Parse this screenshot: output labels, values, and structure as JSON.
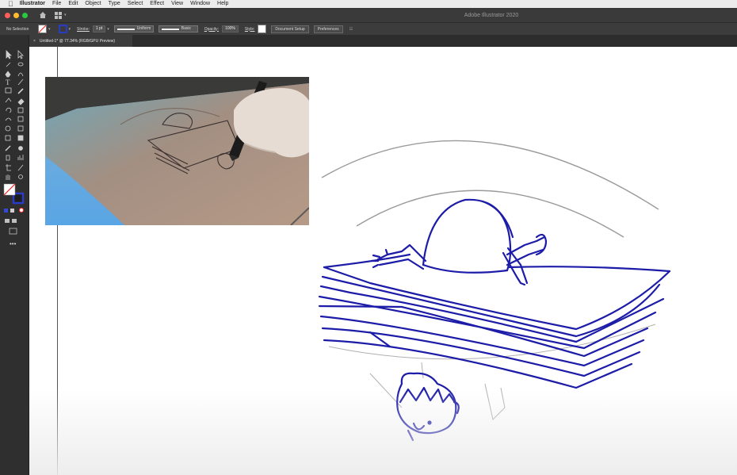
{
  "menubar": {
    "app_name": "Illustrator",
    "items": [
      "File",
      "Edit",
      "Object",
      "Type",
      "Select",
      "Effect",
      "View",
      "Window",
      "Help"
    ]
  },
  "titlebar": {
    "title": "Adobe Illustrator 2020"
  },
  "controlbar": {
    "selection_label": "No Selection",
    "stroke_label": "Stroke:",
    "stroke_weight": "1 pt",
    "profile_value": "Uniform",
    "brush_value": "Basic",
    "opacity_label": "Opacity:",
    "opacity_value": "100%",
    "style_label": "Style:",
    "document_setup_label": "Document Setup",
    "preferences_label": "Preferences"
  },
  "document_tab": {
    "title": "Untitled-1* @ 77.34% (RGB/GPU Preview)"
  },
  "colors": {
    "ink_blue": "#1c1ca8",
    "pencil_gray": "#9a9a9a",
    "ui_dark": "#3c3c3c",
    "stroke_swatch": "#2a3cc4"
  },
  "icons": [
    "apple-icon",
    "home-icon",
    "workspace-icon",
    "close-tab-icon",
    "selection-tool-icon",
    "direct-selection-tool-icon",
    "pen-tool-icon",
    "type-tool-icon",
    "fill-stroke-swatch-icon",
    "edit-toolbar-icon"
  ]
}
